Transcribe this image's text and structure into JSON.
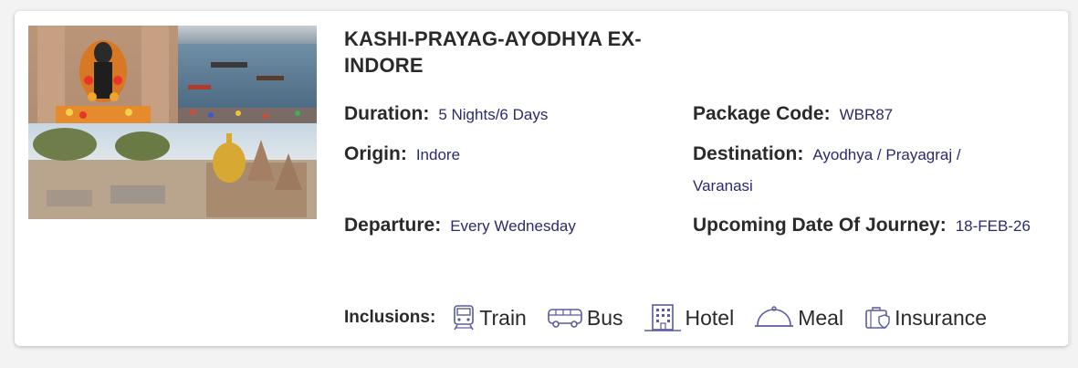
{
  "package": {
    "title": "KASHI-PRAYAG-AYODHYA EX-INDORE"
  },
  "details": {
    "duration_label": "Duration:",
    "duration_value": "5 Nights/6 Days",
    "package_code_label": "Package Code:",
    "package_code_value": "WBR87",
    "origin_label": "Origin:",
    "origin_value": "Indore",
    "destination_label": "Destination:",
    "destination_value": "Ayodhya / Prayagraj / Varanasi",
    "departure_label": "Departure:",
    "departure_value": "Every Wednesday",
    "journey_label": "Upcoming Date Of Journey:",
    "journey_value": "18-FEB-26"
  },
  "inclusions": {
    "label": "Inclusions:",
    "items": [
      {
        "label": "Train",
        "icon": "train-icon"
      },
      {
        "label": "Bus",
        "icon": "bus-icon"
      },
      {
        "label": "Hotel",
        "icon": "hotel-icon"
      },
      {
        "label": "Meal",
        "icon": "meal-icon"
      },
      {
        "label": "Insurance",
        "icon": "insurance-icon"
      }
    ]
  },
  "colors": {
    "value_text": "#2c2a6e",
    "icon_stroke": "#5a5aa0",
    "label_text": "#2a2a2a"
  }
}
